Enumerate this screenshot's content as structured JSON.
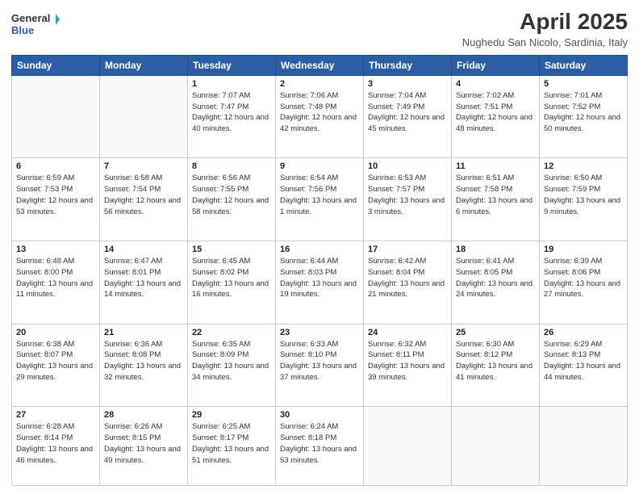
{
  "header": {
    "logo_line1": "General",
    "logo_line2": "Blue",
    "title": "April 2025",
    "subtitle": "Nughedu San Nicolo, Sardinia, Italy"
  },
  "days_of_week": [
    "Sunday",
    "Monday",
    "Tuesday",
    "Wednesday",
    "Thursday",
    "Friday",
    "Saturday"
  ],
  "weeks": [
    [
      {
        "day": "",
        "info": ""
      },
      {
        "day": "",
        "info": ""
      },
      {
        "day": "1",
        "info": "Sunrise: 7:07 AM\nSunset: 7:47 PM\nDaylight: 12 hours and 40 minutes."
      },
      {
        "day": "2",
        "info": "Sunrise: 7:06 AM\nSunset: 7:48 PM\nDaylight: 12 hours and 42 minutes."
      },
      {
        "day": "3",
        "info": "Sunrise: 7:04 AM\nSunset: 7:49 PM\nDaylight: 12 hours and 45 minutes."
      },
      {
        "day": "4",
        "info": "Sunrise: 7:02 AM\nSunset: 7:51 PM\nDaylight: 12 hours and 48 minutes."
      },
      {
        "day": "5",
        "info": "Sunrise: 7:01 AM\nSunset: 7:52 PM\nDaylight: 12 hours and 50 minutes."
      }
    ],
    [
      {
        "day": "6",
        "info": "Sunrise: 6:59 AM\nSunset: 7:53 PM\nDaylight: 12 hours and 53 minutes."
      },
      {
        "day": "7",
        "info": "Sunrise: 6:58 AM\nSunset: 7:54 PM\nDaylight: 12 hours and 56 minutes."
      },
      {
        "day": "8",
        "info": "Sunrise: 6:56 AM\nSunset: 7:55 PM\nDaylight: 12 hours and 58 minutes."
      },
      {
        "day": "9",
        "info": "Sunrise: 6:54 AM\nSunset: 7:56 PM\nDaylight: 13 hours and 1 minute."
      },
      {
        "day": "10",
        "info": "Sunrise: 6:53 AM\nSunset: 7:57 PM\nDaylight: 13 hours and 3 minutes."
      },
      {
        "day": "11",
        "info": "Sunrise: 6:51 AM\nSunset: 7:58 PM\nDaylight: 13 hours and 6 minutes."
      },
      {
        "day": "12",
        "info": "Sunrise: 6:50 AM\nSunset: 7:59 PM\nDaylight: 13 hours and 9 minutes."
      }
    ],
    [
      {
        "day": "13",
        "info": "Sunrise: 6:48 AM\nSunset: 8:00 PM\nDaylight: 13 hours and 11 minutes."
      },
      {
        "day": "14",
        "info": "Sunrise: 6:47 AM\nSunset: 8:01 PM\nDaylight: 13 hours and 14 minutes."
      },
      {
        "day": "15",
        "info": "Sunrise: 6:45 AM\nSunset: 8:02 PM\nDaylight: 13 hours and 16 minutes."
      },
      {
        "day": "16",
        "info": "Sunrise: 6:44 AM\nSunset: 8:03 PM\nDaylight: 13 hours and 19 minutes."
      },
      {
        "day": "17",
        "info": "Sunrise: 6:42 AM\nSunset: 8:04 PM\nDaylight: 13 hours and 21 minutes."
      },
      {
        "day": "18",
        "info": "Sunrise: 6:41 AM\nSunset: 8:05 PM\nDaylight: 13 hours and 24 minutes."
      },
      {
        "day": "19",
        "info": "Sunrise: 6:39 AM\nSunset: 8:06 PM\nDaylight: 13 hours and 27 minutes."
      }
    ],
    [
      {
        "day": "20",
        "info": "Sunrise: 6:38 AM\nSunset: 8:07 PM\nDaylight: 13 hours and 29 minutes."
      },
      {
        "day": "21",
        "info": "Sunrise: 6:36 AM\nSunset: 8:08 PM\nDaylight: 13 hours and 32 minutes."
      },
      {
        "day": "22",
        "info": "Sunrise: 6:35 AM\nSunset: 8:09 PM\nDaylight: 13 hours and 34 minutes."
      },
      {
        "day": "23",
        "info": "Sunrise: 6:33 AM\nSunset: 8:10 PM\nDaylight: 13 hours and 37 minutes."
      },
      {
        "day": "24",
        "info": "Sunrise: 6:32 AM\nSunset: 8:11 PM\nDaylight: 13 hours and 39 minutes."
      },
      {
        "day": "25",
        "info": "Sunrise: 6:30 AM\nSunset: 8:12 PM\nDaylight: 13 hours and 41 minutes."
      },
      {
        "day": "26",
        "info": "Sunrise: 6:29 AM\nSunset: 8:13 PM\nDaylight: 13 hours and 44 minutes."
      }
    ],
    [
      {
        "day": "27",
        "info": "Sunrise: 6:28 AM\nSunset: 8:14 PM\nDaylight: 13 hours and 46 minutes."
      },
      {
        "day": "28",
        "info": "Sunrise: 6:26 AM\nSunset: 8:15 PM\nDaylight: 13 hours and 49 minutes."
      },
      {
        "day": "29",
        "info": "Sunrise: 6:25 AM\nSunset: 8:17 PM\nDaylight: 13 hours and 51 minutes."
      },
      {
        "day": "30",
        "info": "Sunrise: 6:24 AM\nSunset: 8:18 PM\nDaylight: 13 hours and 53 minutes."
      },
      {
        "day": "",
        "info": ""
      },
      {
        "day": "",
        "info": ""
      },
      {
        "day": "",
        "info": ""
      }
    ]
  ]
}
